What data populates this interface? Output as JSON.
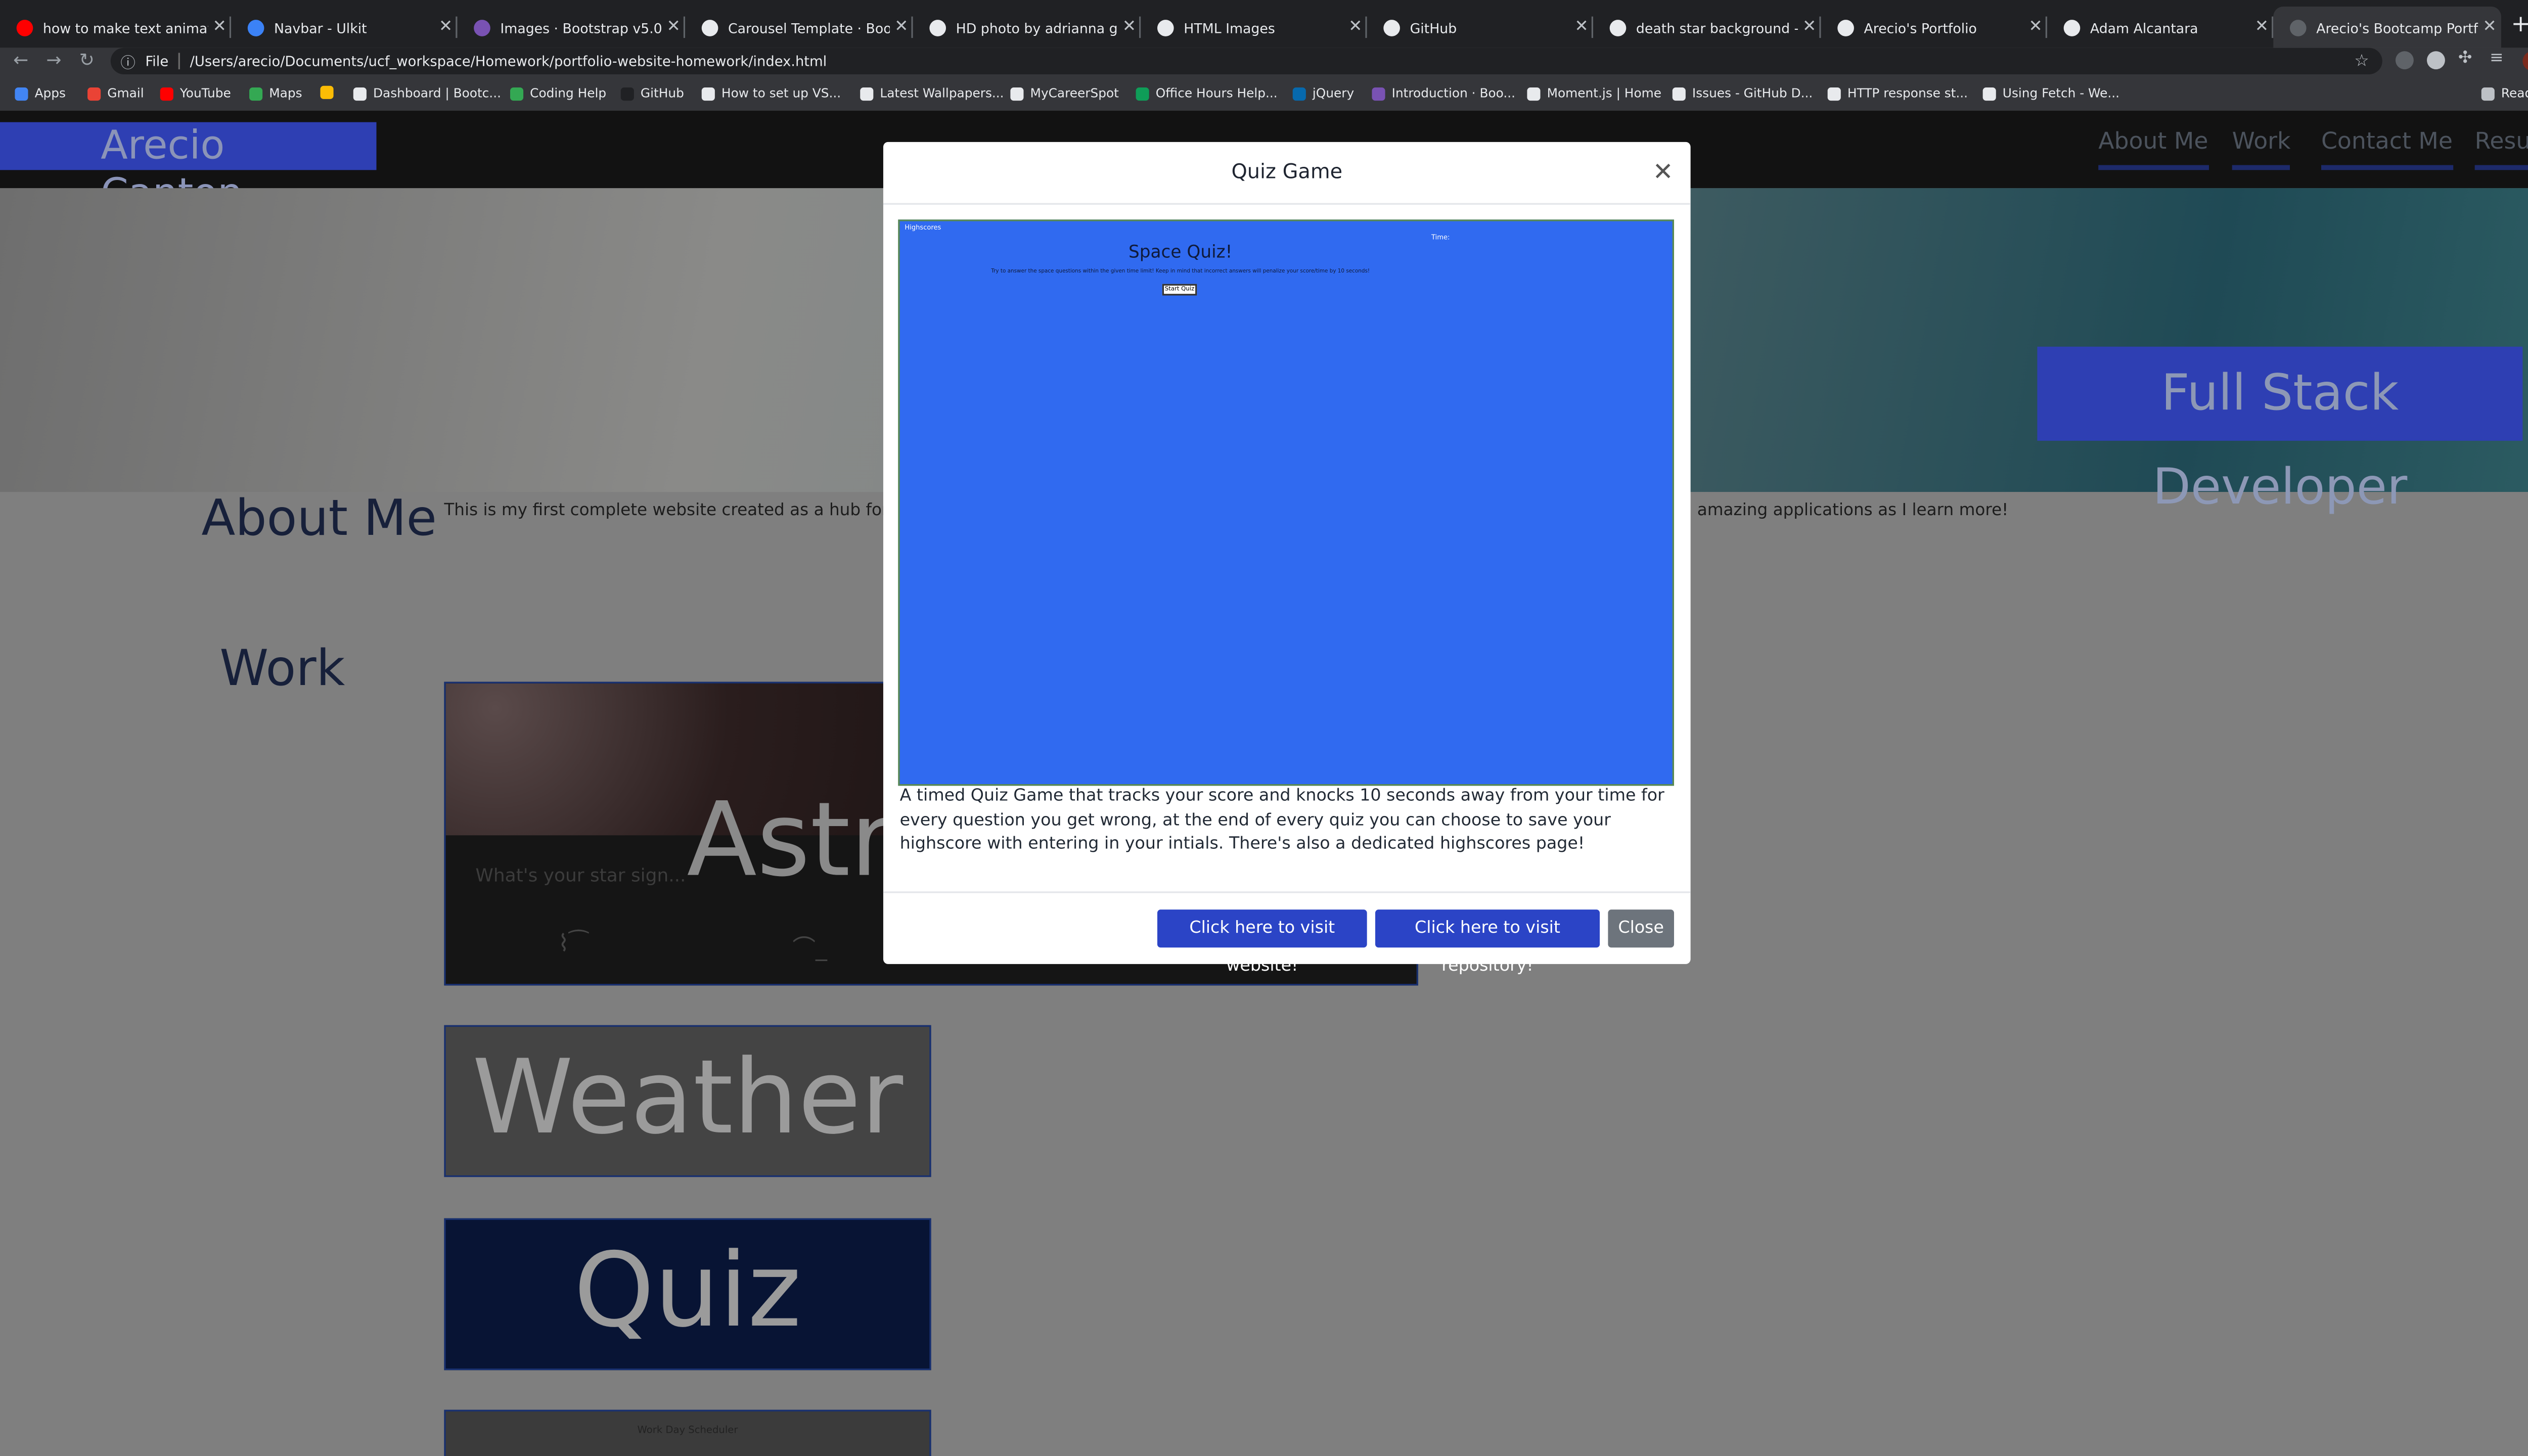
{
  "browser": {
    "tabs": [
      {
        "title": "how to make text animation",
        "favicon_color": "#ff0000"
      },
      {
        "title": "Navbar - Ulkit",
        "favicon_color": "#3b82f6"
      },
      {
        "title": "Images · Bootstrap v5.0",
        "favicon_color": "#7952b3"
      },
      {
        "title": "Carousel Template · Bootstr",
        "favicon_color": "#e8eaed"
      },
      {
        "title": "HD photo by adrianna geo",
        "favicon_color": "#e8eaed"
      },
      {
        "title": "HTML Images",
        "favicon_color": "#e8eaed"
      },
      {
        "title": "GitHub",
        "favicon_color": "#e8eaed"
      },
      {
        "title": "death star background - Go",
        "favicon_color": "#e8eaed"
      },
      {
        "title": "Arecio's Portfolio",
        "favicon_color": "#e8eaed"
      },
      {
        "title": "Adam Alcantara",
        "favicon_color": "#e8eaed"
      },
      {
        "title": "Arecio's Bootcamp Portfolio",
        "favicon_color": "#5f6368"
      }
    ],
    "new_tab": "+",
    "address": {
      "scheme": "File",
      "url": "/Users/arecio/Documents/ucf_workspace/Homework/portfolio-website-homework/index.html"
    },
    "bookmarks": [
      {
        "label": "Apps",
        "color": "#4285f4"
      },
      {
        "label": "Gmail",
        "color": "#ea4335"
      },
      {
        "label": "YouTube",
        "color": "#ff0000"
      },
      {
        "label": "Maps",
        "color": "#34a853"
      },
      {
        "label": "",
        "color": "#fbbc05"
      },
      {
        "label": "Dashboard | Bootc...",
        "color": "#e8eaed"
      },
      {
        "label": "Coding Help",
        "color": "#34a853"
      },
      {
        "label": "GitHub",
        "color": "#202124"
      },
      {
        "label": "How to set up VS...",
        "color": "#e8eaed"
      },
      {
        "label": "Latest Wallpapers...",
        "color": "#e8eaed"
      },
      {
        "label": "MyCareerSpot",
        "color": "#e8eaed"
      },
      {
        "label": "Office Hours Help...",
        "color": "#0f9d58"
      },
      {
        "label": "jQuery",
        "color": "#0769ad"
      },
      {
        "label": "Introduction · Boo...",
        "color": "#7952b3"
      },
      {
        "label": "Moment.js | Home",
        "color": "#e8eaed"
      },
      {
        "label": "Issues - GitHub D...",
        "color": "#e8eaed"
      },
      {
        "label": "HTTP response st...",
        "color": "#e8eaed"
      },
      {
        "label": "Using Fetch - We...",
        "color": "#e8eaed"
      }
    ],
    "reading_list": "Reading List"
  },
  "site": {
    "brand": "Arecio Canton",
    "nav": [
      "About Me",
      "Work",
      "Contact Me",
      "Resume"
    ],
    "hero_badge": "Full Stack Developer",
    "about_heading": "About Me",
    "about_text_left": "This is my first complete website created as a hub for all my",
    "about_text_right": "amazing applications as I learn more!",
    "work_heading": "Work",
    "cards": {
      "astro": {
        "title": "Astro",
        "prompt": "What's your star sign..."
      },
      "weather": {
        "title": "Weather"
      },
      "quiz": {
        "title": "Quiz"
      },
      "scheduler": {
        "title": "Work Day Scheduler"
      }
    }
  },
  "modal": {
    "title": "Quiz Game",
    "preview": {
      "highscores": "Highscores",
      "time": "Time:",
      "heading": "Space Quiz!",
      "subtitle": "Try to answer the space questions within the given time limit! Keep in mind that incorrect answers will penalize your score/time by 10 seconds!",
      "start": "Start Quiz"
    },
    "description": "A timed Quiz Game that tracks your score and knocks 10 seconds away from your time for every question you get wrong, at the end of every quiz you can choose to save your highscore with entering in your intials. There's also a dedicated highscores page!",
    "buttons": {
      "website": "Click here to visit website!",
      "repository": "Click here to visit repository!",
      "close": "Close"
    }
  }
}
